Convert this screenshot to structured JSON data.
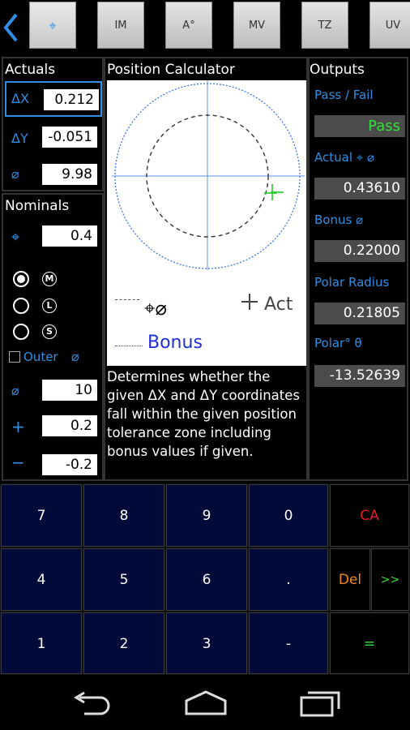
{
  "toolbar": {
    "back_icon": "chevron-left-icon",
    "buttons": [
      {
        "label": "⌖",
        "selected": true
      },
      {
        "label": "IM",
        "selected": false
      },
      {
        "label": "A°",
        "selected": false
      },
      {
        "label": "MV",
        "selected": false
      },
      {
        "label": "TZ",
        "selected": false
      },
      {
        "label": "UV",
        "selected": false
      }
    ]
  },
  "actuals": {
    "title": "Actuals",
    "dx_label": "ΔX",
    "dx_value": "0.212",
    "dy_label": "ΔY",
    "dy_value": "-0.051",
    "dia_label": "⌀",
    "dia_value": "9.98"
  },
  "nominals": {
    "title": "Nominals",
    "pos_symbol": "⌖",
    "pos_value": "0.4",
    "modifiers": [
      {
        "letter": "M",
        "selected": true
      },
      {
        "letter": "L",
        "selected": false
      },
      {
        "letter": "S",
        "selected": false
      }
    ],
    "outer_label": "Outer",
    "outer_symbol": "⌀",
    "outer_checked": false,
    "dia_label": "⌀",
    "dia_value": "10",
    "plus_label": "+",
    "plus_value": "0.2",
    "minus_label": "−",
    "minus_value": "-0.2"
  },
  "calculator": {
    "title": "Position Calculator",
    "legend_tol_symbol": "⌖⌀",
    "legend_act_label": "Act",
    "legend_bonus_label": "Bonus",
    "description": "Determines whether the given ΔX and ΔY coordinates fall within the given position tolerance zone including bonus values if given."
  },
  "outputs": {
    "title": "Outputs",
    "passfail_label": "Pass / Fail",
    "passfail_value": "Pass",
    "actual_label": "Actual ⌖ ⌀",
    "actual_value": "0.43610",
    "bonus_label": "Bonus ⌀",
    "bonus_value": "0.22000",
    "polar_radius_label": "Polar Radius",
    "polar_radius_value": "0.21805",
    "polar_angle_label": "Polar° θ",
    "polar_angle_value": "-13.52639"
  },
  "keypad": {
    "row1": [
      "7",
      "8",
      "9",
      "0"
    ],
    "row2": [
      "4",
      "5",
      "6",
      "."
    ],
    "row3": [
      "1",
      "2",
      "3",
      "-"
    ],
    "clear_label": "CA",
    "delete_label": "Del",
    "next_label": ">>",
    "equals_label": "="
  },
  "colors": {
    "accent": "#2f8fe6",
    "pass": "#33e03a",
    "clear": "#e02020",
    "delete": "#f0891c",
    "next": "#33e03a",
    "key_bg": "#020a3a"
  },
  "navbar": {
    "back_icon": "nav-back-icon",
    "home_icon": "nav-home-icon",
    "recents_icon": "nav-recents-icon"
  }
}
